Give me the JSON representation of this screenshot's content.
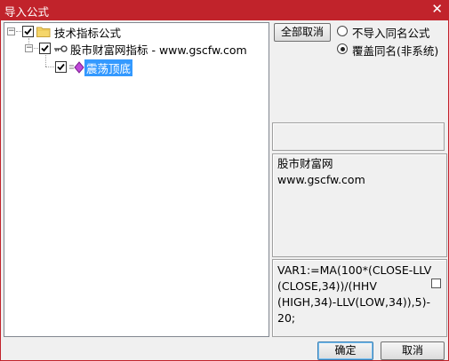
{
  "window": {
    "title": "导入公式",
    "close_glyph": "✕"
  },
  "tree": {
    "root": {
      "label": "技术指标公式",
      "expander": "−",
      "checked": true
    },
    "child": {
      "label": "股市财富网指标 - www.gscfw.com",
      "expander": "−",
      "checked": true
    },
    "leaf": {
      "label": "震荡顶底",
      "checked": true,
      "selected": true
    }
  },
  "options": {
    "select_all_label": "全部取消",
    "radio_no_import": "不导入同名公式",
    "radio_overwrite": "覆盖同名(非系统)",
    "selected_radio": "overwrite"
  },
  "info": {
    "line1": "股市财富网",
    "line2": "www.gscfw.com"
  },
  "formula": {
    "line1": "VAR1:=MA(100*(CLOSE-LLV",
    "line2": "(CLOSE,34))/(HHV",
    "line3": "(HIGH,34)-LLV(LOW,34)),5)-",
    "line4": "20;"
  },
  "buttons": {
    "ok": "确定",
    "cancel": "取消"
  },
  "colors": {
    "titlebar": "#c1232b",
    "selection": "#3399ff"
  },
  "icons": {
    "folder": "folder-icon",
    "key": "key-icon",
    "formula": "diamond-formula-icon"
  }
}
